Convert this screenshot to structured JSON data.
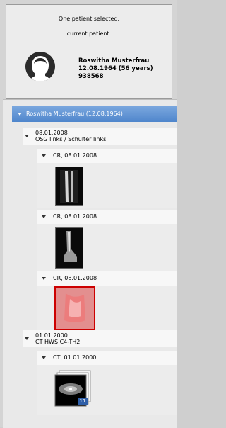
{
  "header": {
    "selection_status": "One patient selected.",
    "current_label": "current patient:",
    "patient_name": "Roswitha Musterfrau",
    "patient_dob": "12.08.1964 (56 years)",
    "patient_id": "938568"
  },
  "tree": {
    "patient_label": "Roswitha Musterfrau (12.08.1964)",
    "studies": [
      {
        "date": "08.01.2008",
        "description": "OSG links / Schulter links",
        "series": [
          {
            "label": "CR, 08.01.2008"
          },
          {
            "label": "CR, 08.01.2008"
          },
          {
            "label": "CR, 08.01.2008"
          }
        ]
      },
      {
        "date": "01.01.2000",
        "description": "CT HWS C4-TH2",
        "series": [
          {
            "label": "CT, 01.01.2000",
            "badge": "11"
          }
        ]
      }
    ]
  },
  "colors": {
    "selection": "#5b8fd3",
    "selected_thumb_border": "#cc0000"
  }
}
